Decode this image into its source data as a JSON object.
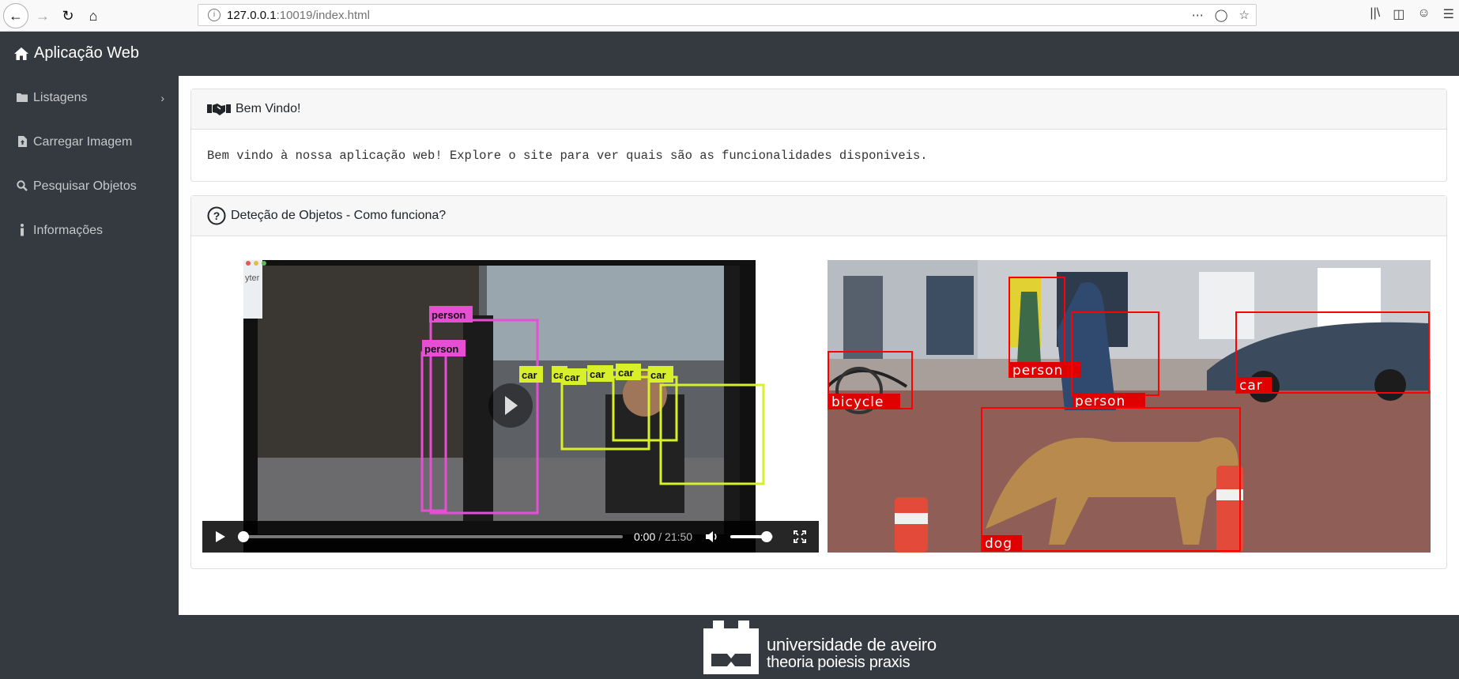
{
  "browser": {
    "url_host": "127.0.0.1",
    "url_rest": ":10019/index.html"
  },
  "navbar": {
    "brand": "Aplicação Web"
  },
  "sidebar": {
    "items": [
      {
        "label": "Listagens",
        "icon": "folder-icon"
      },
      {
        "label": "Carregar Imagem",
        "icon": "file-upload-icon"
      },
      {
        "label": "Pesquisar Objetos",
        "icon": "search-icon"
      },
      {
        "label": "Informações",
        "icon": "info-icon"
      }
    ]
  },
  "welcome": {
    "title": "Bem Vindo!",
    "text": "Bem vindo à nossa aplicação web! Explore o site para ver quais são as funcionalidades disponiveis."
  },
  "detection": {
    "title": "Deteção de Objetos - Como funciona?",
    "video": {
      "time_current": "0:00",
      "time_total": "/ 21:50",
      "volume": 0.85,
      "progress": 0.0
    },
    "video_labels": [
      "person",
      "person",
      "car",
      "car",
      "car",
      "car",
      "car",
      "car"
    ],
    "image_labels": [
      "person",
      "person",
      "car",
      "bicycle",
      "dog"
    ]
  },
  "footer": {
    "line1": "universidade de aveiro",
    "line2": "theoria poiesis praxis"
  }
}
